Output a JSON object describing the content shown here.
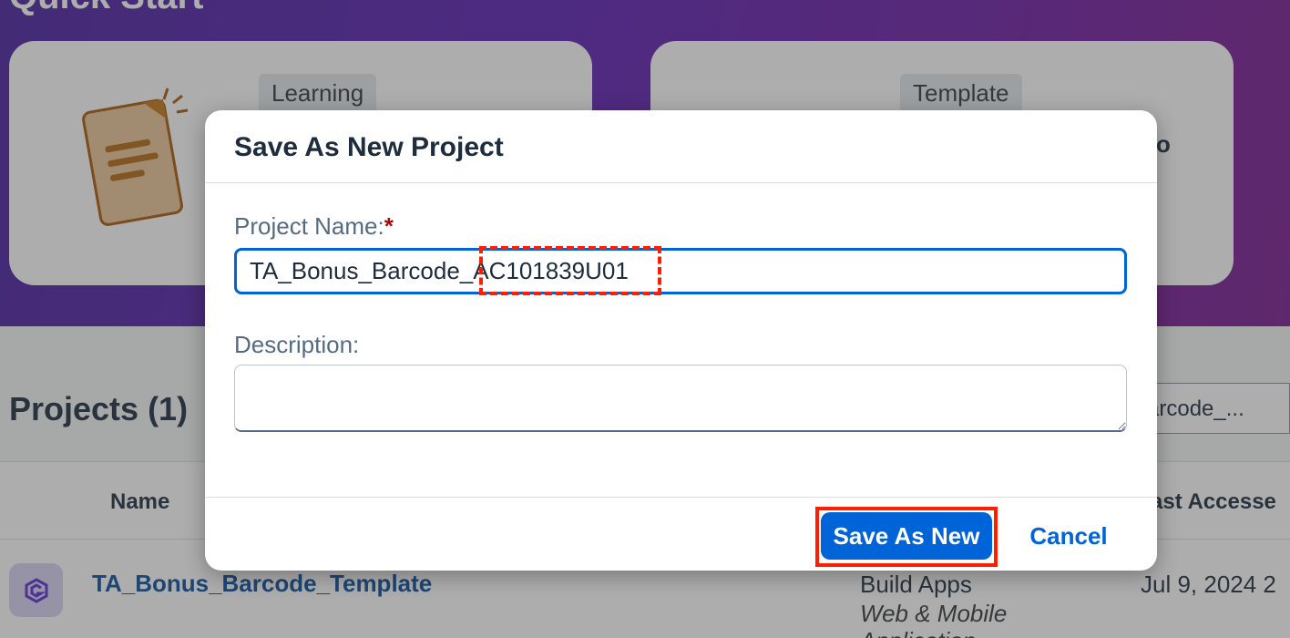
{
  "quick_start": {
    "title": "Quick Start",
    "cards": [
      {
        "tag": "Learning",
        "icon": "document-icon"
      },
      {
        "tag": "Template",
        "text_fragment": "o"
      }
    ]
  },
  "projects": {
    "title": "Projects (1)",
    "search_value": "arcode_...",
    "columns": {
      "name": "Name",
      "last_accessed": "ast Accesse"
    },
    "rows": [
      {
        "name": "TA_Bonus_Barcode_Template",
        "type": "Build Apps",
        "subtype": "Web & Mobile",
        "subtype2": "Application",
        "last_accessed": "Jul 9, 2024 2"
      }
    ]
  },
  "dialog": {
    "title": "Save As New Project",
    "project_name_label": "Project Name:",
    "required_mark": "*",
    "project_name_value": "TA_Bonus_Barcode_AC101839U01",
    "description_label": "Description:",
    "description_value": "",
    "save_label": "Save As New",
    "cancel_label": "Cancel"
  },
  "colors": {
    "accent": "#0064d9",
    "highlight": "#ff1f00",
    "hero_gradient_start": "#4a1fa0",
    "hero_gradient_end": "#7a1a90"
  }
}
